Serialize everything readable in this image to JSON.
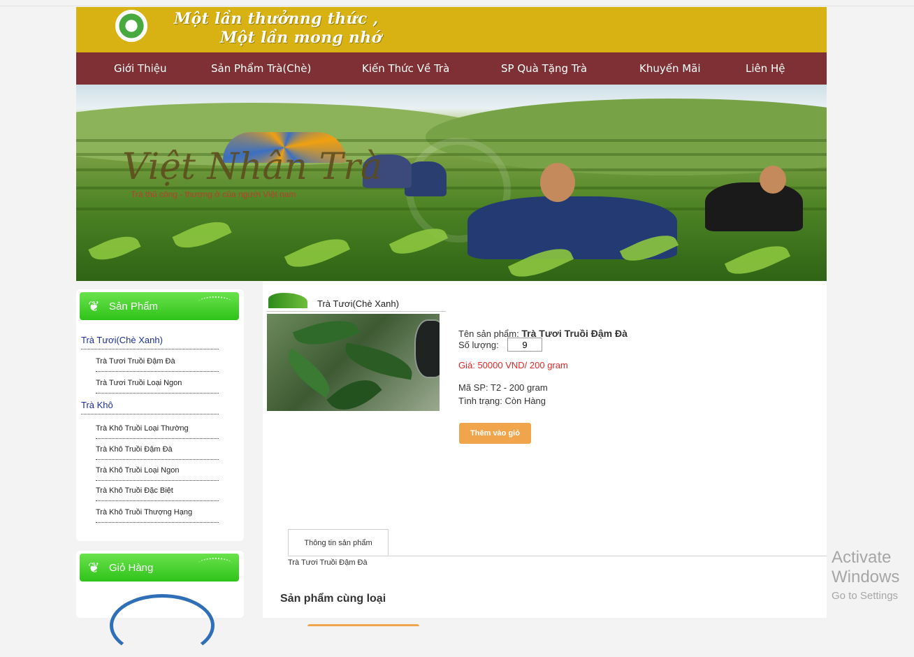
{
  "header": {
    "slogan_line1": "Một lần thưởnng thức ,",
    "slogan_line2": "Một lần mong nhớ"
  },
  "nav": {
    "items": [
      {
        "label": "Giới Thiệu"
      },
      {
        "label": "Sản Phẩm Trà(Chè)"
      },
      {
        "label": "Kiến Thức Về Trà"
      },
      {
        "label": "SP Quà Tặng Trà"
      },
      {
        "label": "Khuyến Mãi"
      },
      {
        "label": "Liên Hệ"
      }
    ]
  },
  "banner": {
    "title": "Việt Nhân Trà",
    "subtitle": "Trà thủ công - thương ở của người Việt nam"
  },
  "sidebar": {
    "products_heading": "Sản Phẩm",
    "categories": [
      {
        "label": "Trà Tươi(Chè Xanh)",
        "items": [
          "Trà Tươi Truồi Đậm Đà",
          "Trà Tươi Truồi Loại Ngon"
        ]
      },
      {
        "label": "Trà Khô",
        "items": [
          "Trà Khô Truồi Loại Thường",
          "Trà Khô Truồi Đậm Đà",
          "Trà Khô Truồi Loại Ngon",
          "Trà Khô Truồi Đặc Biệt",
          "Trà Khô Truồi Thượng Hạng"
        ]
      }
    ],
    "cart_heading": "Giỏ Hàng"
  },
  "product": {
    "category_title": "Trà Tươi(Chè Xanh)",
    "name_label": "Tên sản phẩm:",
    "name": "Trà Tươi Truồi Đậm Đà",
    "quantity_label": "Số lượng:",
    "quantity": "9",
    "price": "Giá: 50000 VND/ 200 gram",
    "sku": "Mã SP: T2 - 200 gram",
    "status": "Tình trạng: Còn Hàng",
    "add_to_cart": "Thêm vào giỏ"
  },
  "tabs": {
    "info_tab": "Thông tin sản phẩm",
    "info_content": "Trà Tươi Truồi Đậm Đà"
  },
  "related": {
    "title": "Sản phẩm cùng loại"
  },
  "watermark": {
    "line1": "Activate Windows",
    "line2": "Go to Settings"
  },
  "colors": {
    "header_bg": "#d8b213",
    "nav_bg": "#7e3035",
    "sidebar_head": "#3fcf28",
    "link_blue": "#1c2f9c",
    "price_red": "#e52828",
    "button_orange": "#f0a54d"
  }
}
